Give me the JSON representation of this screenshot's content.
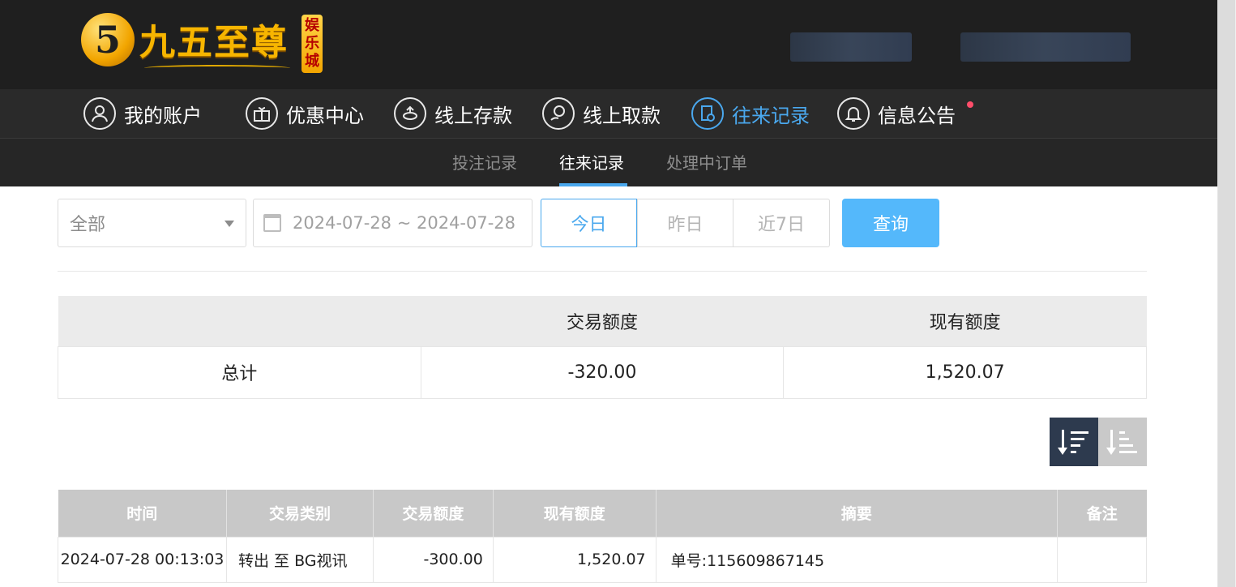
{
  "brand": {
    "logo_mark": "5",
    "logo_text": "九五至尊",
    "logo_badge": "娱乐城"
  },
  "main_nav": [
    {
      "label": "我的账户",
      "icon": "user-icon",
      "active": false
    },
    {
      "label": "优惠中心",
      "icon": "gift-icon",
      "active": false
    },
    {
      "label": "线上存款",
      "icon": "deposit-icon",
      "active": false
    },
    {
      "label": "线上取款",
      "icon": "withdraw-icon",
      "active": false
    },
    {
      "label": "往来记录",
      "icon": "records-icon",
      "active": true
    },
    {
      "label": "信息公告",
      "icon": "bell-icon",
      "active": false
    }
  ],
  "sub_nav": [
    {
      "label": "投注记录",
      "active": false
    },
    {
      "label": "往来记录",
      "active": true
    },
    {
      "label": "处理中订单",
      "active": false
    }
  ],
  "filter": {
    "type_select": "全部",
    "date_range": "2024-07-28 ~ 2024-07-28",
    "quick_today": "今日",
    "quick_yesterday": "昨日",
    "quick_7days": "近7日",
    "query_button": "查询"
  },
  "summary": {
    "headers": [
      "",
      "交易额度",
      "现有额度"
    ],
    "row_label": "总计",
    "trade_amount": "-320.00",
    "balance": "1,520.07"
  },
  "sort": {
    "active": "desc"
  },
  "records": {
    "headers": [
      "时间",
      "交易类别",
      "交易额度",
      "现有额度",
      "摘要",
      "备注"
    ],
    "rows": [
      {
        "time": "2024-07-28 00:13:03",
        "type": "转出 至 BG视讯",
        "amount": "-300.00",
        "balance": "1,520.07",
        "summary": "单号:115609867145",
        "note": ""
      }
    ]
  },
  "colors": {
    "header_bg": "#1f1f1f",
    "nav_bg": "#2a2a2a",
    "accent": "#4aa8ee",
    "query_button": "#54b8fb",
    "sort_active": "#2d3a4e",
    "notify_dot": "#ff4d6a"
  }
}
